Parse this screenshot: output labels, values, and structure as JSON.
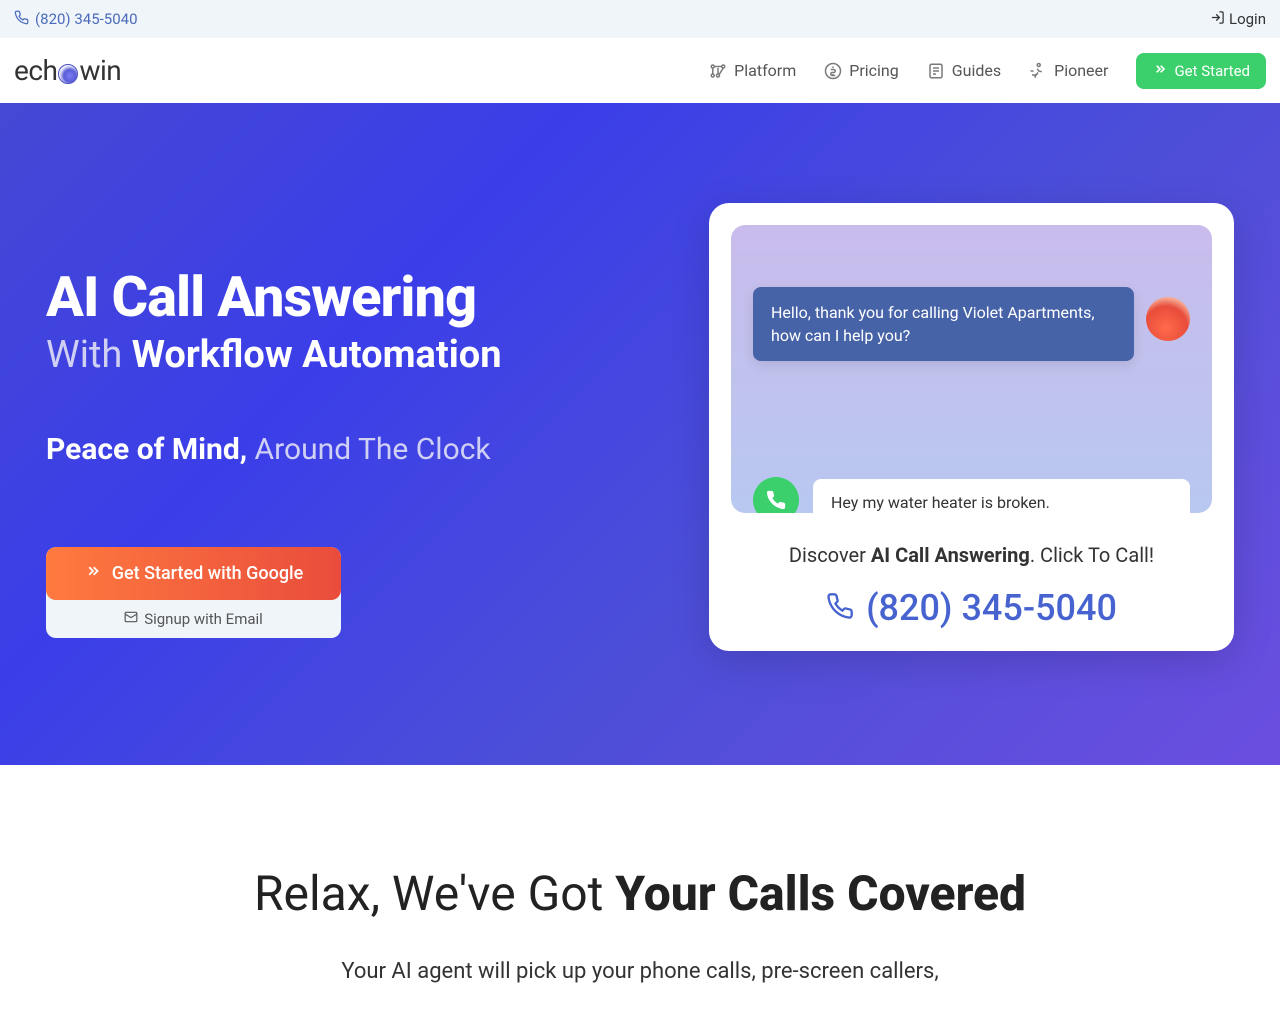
{
  "topbar": {
    "phone": "(820) 345-5040",
    "login": "Login"
  },
  "logo": {
    "prefix": "ech",
    "suffix": "win"
  },
  "nav": {
    "platform": "Platform",
    "pricing": "Pricing",
    "guides": "Guides",
    "pioneer": "Pioneer",
    "get_started": "Get Started"
  },
  "hero": {
    "title": "AI Call Answering",
    "subtitle_prefix": "With ",
    "subtitle_bold": "Workflow Automation",
    "tagline_bold": "Peace of Mind,",
    "tagline_suffix": " Around The Clock",
    "cta_primary": "Get Started with Google",
    "cta_secondary": "Signup with Email"
  },
  "chat": {
    "ai_message": "Hello, thank you for calling Violet Apartments, how can I help you?",
    "user_message": "Hey my water heater is broken."
  },
  "discover": {
    "prefix": "Discover ",
    "bold": "AI Call Answering",
    "suffix": ". Click To Call!",
    "phone": "(820) 345-5040"
  },
  "section2": {
    "title_prefix": "Relax, We've Got ",
    "title_bold": "Your Calls Covered",
    "body": "Your AI agent will pick up your phone calls, pre-screen callers,"
  }
}
